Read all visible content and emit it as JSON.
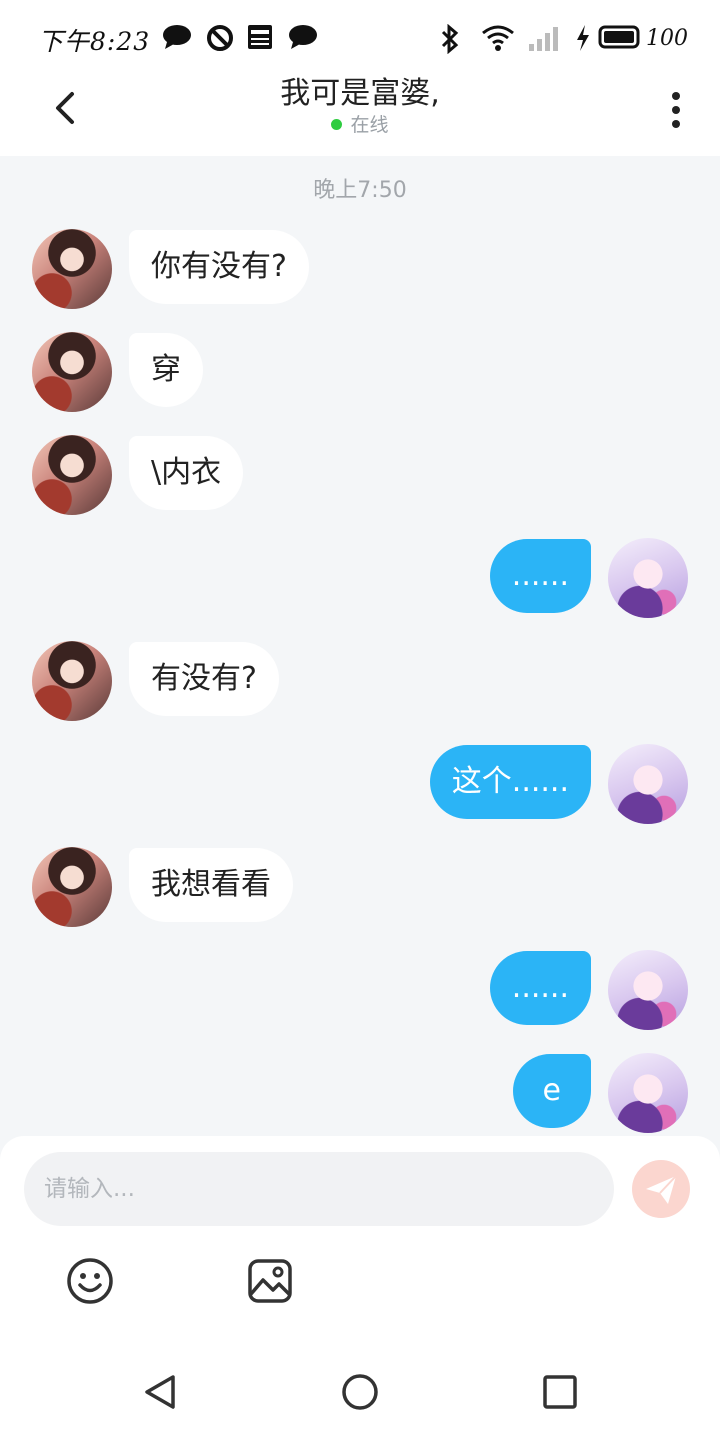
{
  "status_bar": {
    "time": "下午8:23",
    "battery": "100",
    "icons": [
      "chat-bubble-icon",
      "block-icon",
      "news-icon",
      "chat-bubble-icon",
      "bluetooth-icon",
      "wifi-icon",
      "signal-icon",
      "charging-icon",
      "battery-icon"
    ]
  },
  "header": {
    "title": "我可是富婆,",
    "status": "在线",
    "status_color": "#2ecc40"
  },
  "chat": {
    "time_label": "晚上7:50",
    "messages": [
      {
        "side": "in",
        "text": "你有没有?"
      },
      {
        "side": "in",
        "text": "穿"
      },
      {
        "side": "in",
        "text": "\\内衣"
      },
      {
        "side": "out",
        "text": "......"
      },
      {
        "side": "in",
        "text": "有没有?"
      },
      {
        "side": "out",
        "text": "这个......"
      },
      {
        "side": "in",
        "text": "我想看看"
      },
      {
        "side": "out",
        "text": "......"
      },
      {
        "side": "out",
        "text": "e"
      }
    ]
  },
  "input": {
    "placeholder": "请输入...",
    "value": ""
  },
  "colors": {
    "accent": "#2bb4f6",
    "send_button": "#fbd6cf",
    "background": "#f4f6f8"
  }
}
